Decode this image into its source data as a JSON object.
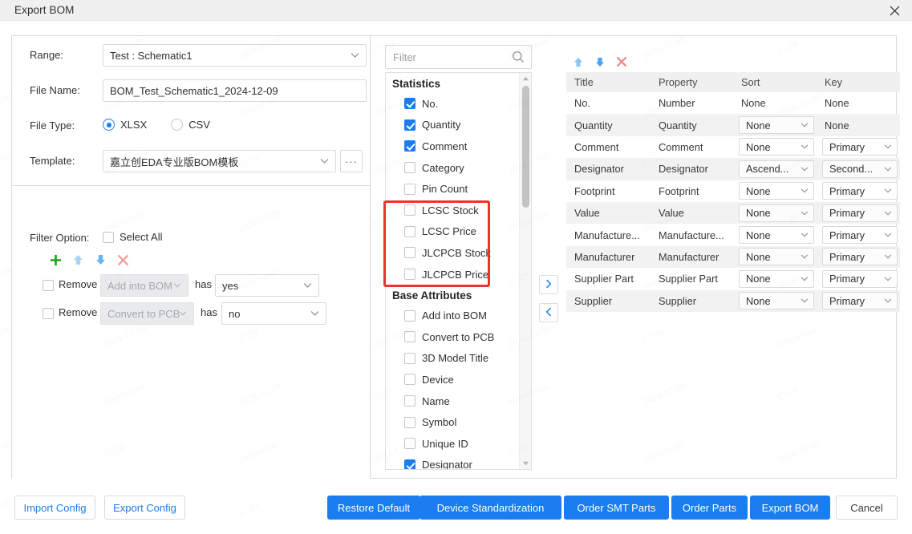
{
  "window": {
    "title": "Export BOM",
    "close_icon": "close-icon"
  },
  "form": {
    "range_label": "Range:",
    "range_value": "Test : Schematic1",
    "filename_label": "File Name:",
    "filename_value": "BOM_Test_Schematic1_2024-12-09",
    "filetype_label": "File Type:",
    "filetype_options": [
      {
        "label": "XLSX",
        "selected": true
      },
      {
        "label": "CSV",
        "selected": false
      }
    ],
    "template_label": "Template:",
    "template_value": "嘉立创EDA专业版BOM模板",
    "template_more_label": "···"
  },
  "filter_option": {
    "label": "Filter Option:",
    "select_all_label": "Select All",
    "select_all_checked": false,
    "toolbar": [
      {
        "name": "add-icon",
        "glyph": "+",
        "color": "#18a318"
      },
      {
        "name": "move-up-icon",
        "glyph": "▲",
        "color": "#a8d3f5"
      },
      {
        "name": "move-down-icon",
        "glyph": "▼",
        "color": "#6ab4ef"
      },
      {
        "name": "delete-icon",
        "glyph": "✕",
        "color": "#f3a1a1"
      }
    ],
    "rows": [
      {
        "checked": false,
        "remove_label": "Remove",
        "field": "Add into BOM",
        "has_label": "has",
        "value": "yes"
      },
      {
        "checked": false,
        "remove_label": "Remove",
        "field": "Convert to PCB",
        "has_label": "has",
        "value": "no"
      }
    ]
  },
  "available": {
    "search_placeholder": "Filter",
    "search_value": "",
    "search_icon": "search-icon",
    "groups": [
      {
        "title": "Statistics",
        "items": [
          {
            "label": "No.",
            "checked": true
          },
          {
            "label": "Quantity",
            "checked": true
          },
          {
            "label": "Comment",
            "checked": true
          },
          {
            "label": "Category",
            "checked": false
          },
          {
            "label": "Pin Count",
            "checked": false
          },
          {
            "label": "LCSC Stock",
            "checked": false
          },
          {
            "label": "LCSC Price",
            "checked": false
          },
          {
            "label": "JLCPCB Stock",
            "checked": false
          },
          {
            "label": "JLCPCB Price",
            "checked": false
          }
        ]
      },
      {
        "title": "Base Attributes",
        "items": [
          {
            "label": "Add into BOM",
            "checked": false
          },
          {
            "label": "Convert to PCB",
            "checked": false
          },
          {
            "label": "3D Model Title",
            "checked": false
          },
          {
            "label": "Device",
            "checked": false
          },
          {
            "label": "Name",
            "checked": false
          },
          {
            "label": "Symbol",
            "checked": false
          },
          {
            "label": "Unique ID",
            "checked": false
          },
          {
            "label": "Designator",
            "checked": true
          }
        ]
      }
    ],
    "highlight_color": "#f0312e"
  },
  "transfer": {
    "to_right_icon": "chevron-right-icon",
    "to_left_icon": "chevron-left-icon"
  },
  "selected_table": {
    "toolbar": [
      {
        "name": "move-up-icon",
        "glyph": "▲",
        "color": "#8cc4f2"
      },
      {
        "name": "move-down-icon",
        "glyph": "▼",
        "color": "#4ba3ed"
      },
      {
        "name": "delete-icon",
        "glyph": "✕",
        "color": "#f08a8a"
      }
    ],
    "headers": [
      "Title",
      "Property",
      "Sort",
      "Key"
    ],
    "rows": [
      {
        "title": "No.",
        "property": "Number",
        "sort": "None",
        "sort_select": false,
        "key": "None",
        "key_select": false
      },
      {
        "title": "Quantity",
        "property": "Quantity",
        "sort": "None",
        "sort_select": true,
        "key": "None",
        "key_select": false
      },
      {
        "title": "Comment",
        "property": "Comment",
        "sort": "None",
        "sort_select": true,
        "key": "Primary",
        "key_select": true
      },
      {
        "title": "Designator",
        "property": "Designator",
        "sort": "Ascend...",
        "sort_select": true,
        "key": "Second...",
        "key_select": true
      },
      {
        "title": "Footprint",
        "property": "Footprint",
        "sort": "None",
        "sort_select": true,
        "key": "Primary",
        "key_select": true
      },
      {
        "title": "Value",
        "property": "Value",
        "sort": "None",
        "sort_select": true,
        "key": "Primary",
        "key_select": true
      },
      {
        "title": "Manufacture...",
        "property": "Manufacture...",
        "sort": "None",
        "sort_select": true,
        "key": "Primary",
        "key_select": true
      },
      {
        "title": "Manufacturer",
        "property": "Manufacturer",
        "sort": "None",
        "sort_select": true,
        "key": "Primary",
        "key_select": true
      },
      {
        "title": "Supplier Part",
        "property": "Supplier Part",
        "sort": "None",
        "sort_select": true,
        "key": "Primary",
        "key_select": true
      },
      {
        "title": "Supplier",
        "property": "Supplier",
        "sort": "None",
        "sort_select": true,
        "key": "Primary",
        "key_select": true
      }
    ]
  },
  "footer": {
    "left_buttons": [
      {
        "label": "Import Config",
        "style": "ghost"
      },
      {
        "label": "Export Config",
        "style": "ghost"
      }
    ],
    "right_buttons": [
      {
        "label": "Restore Default",
        "style": "primary"
      },
      {
        "label": "Device Standardization",
        "style": "primary"
      },
      {
        "label": "Order SMT Parts",
        "style": "primary"
      },
      {
        "label": "Order Parts",
        "style": "primary"
      },
      {
        "label": "Export BOM",
        "style": "primary"
      },
      {
        "label": "Cancel",
        "style": "cancel"
      }
    ],
    "accent_color": "#1a7ef0"
  }
}
